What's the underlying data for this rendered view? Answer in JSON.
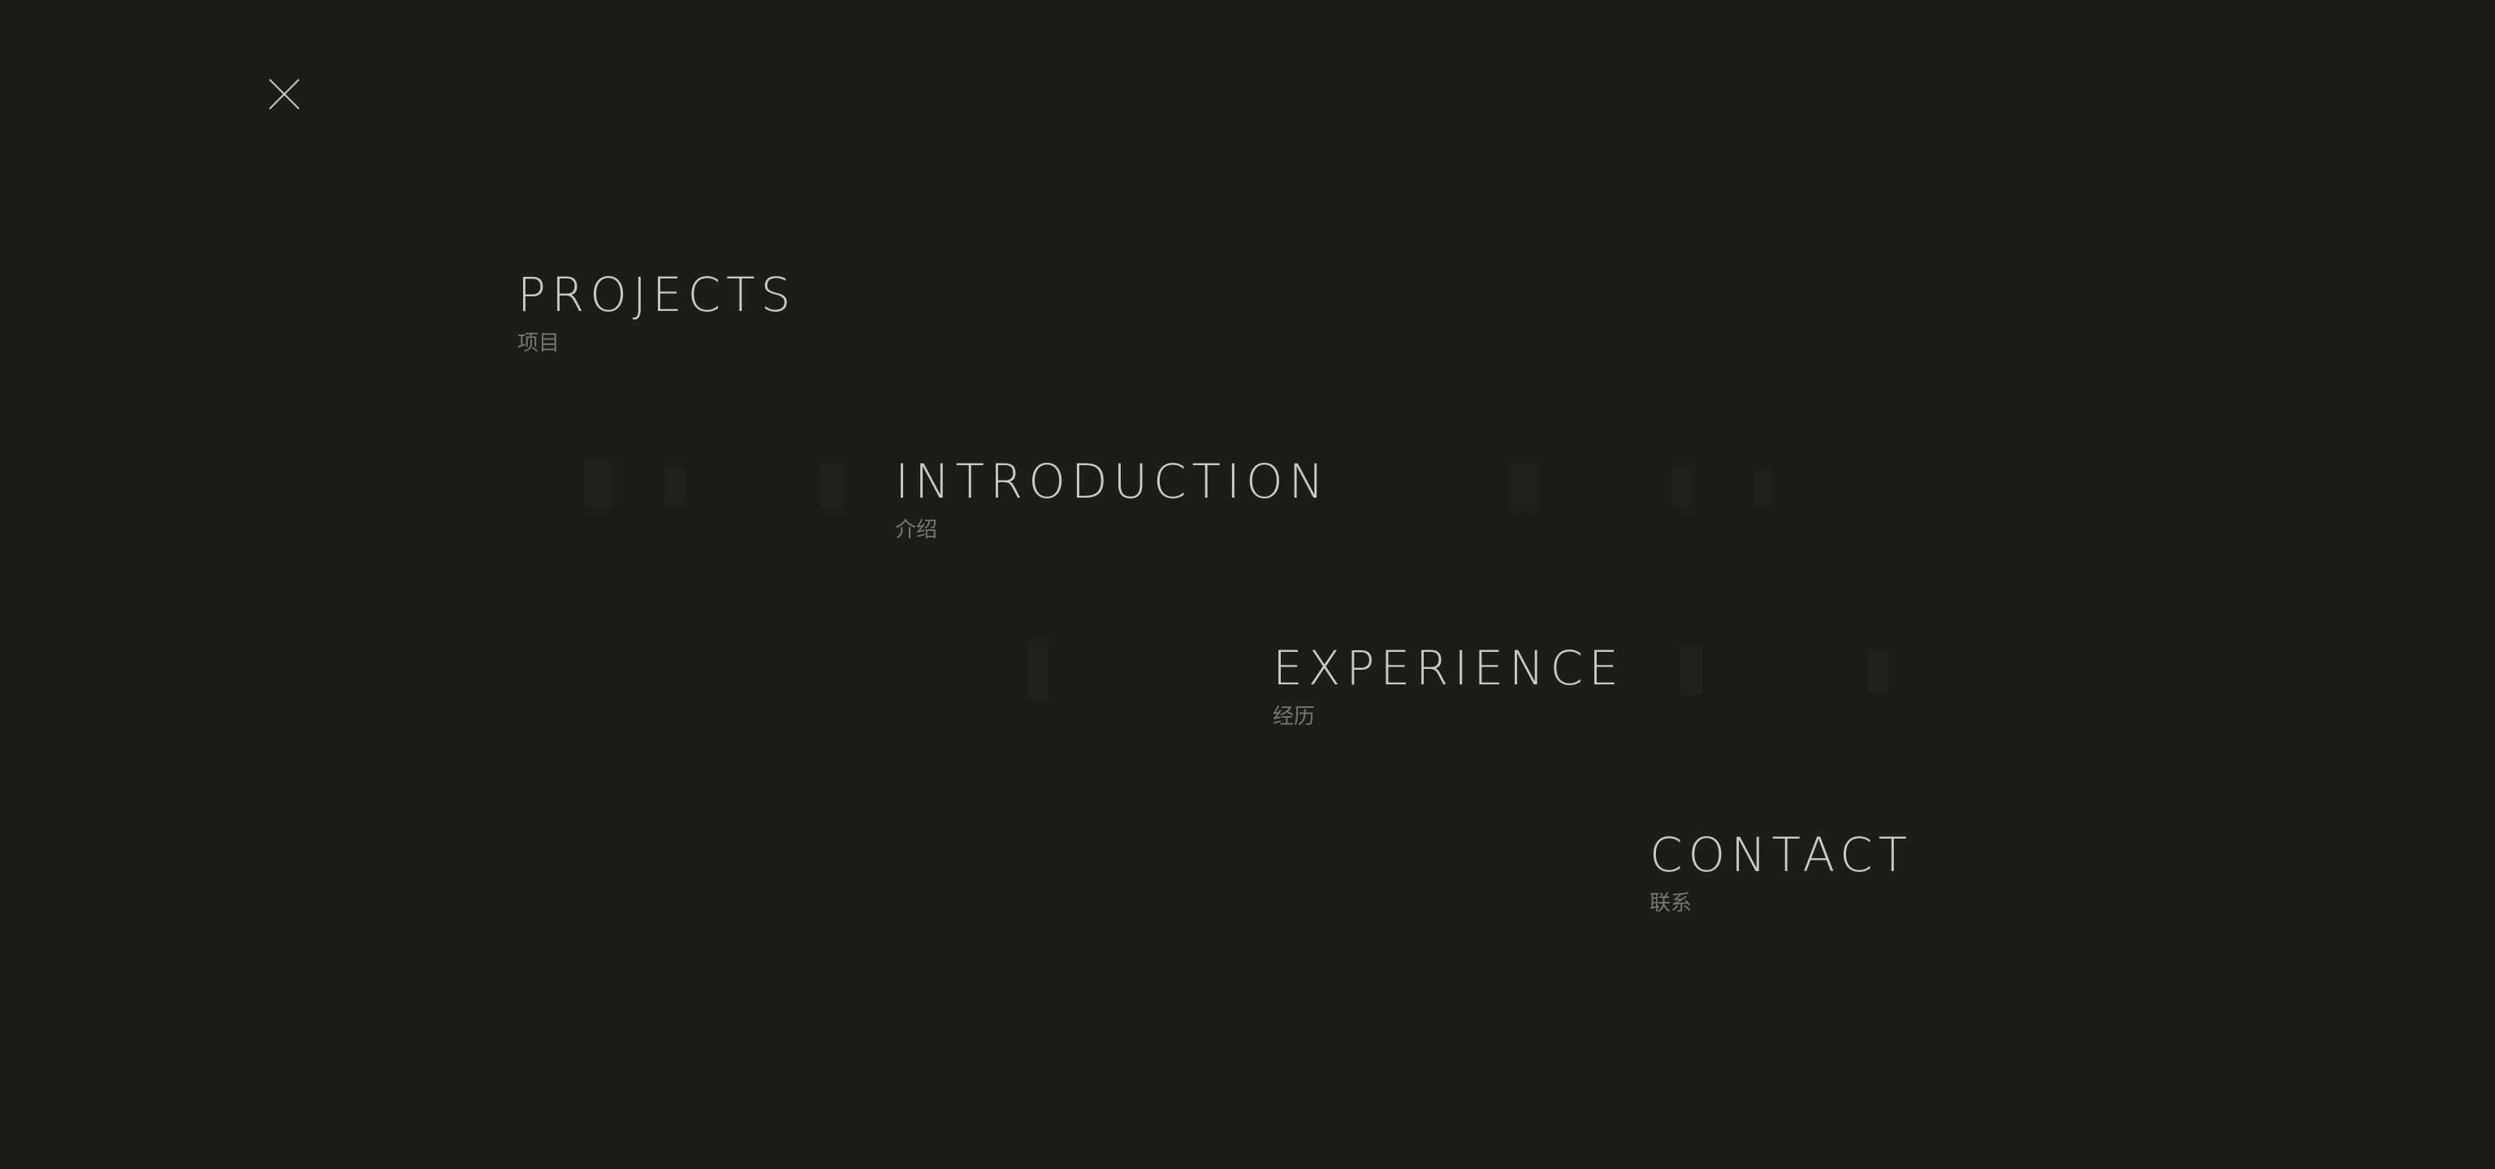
{
  "menu": {
    "close_icon": "close-icon",
    "items": [
      {
        "title": "PROJECTS",
        "subtitle": "项目"
      },
      {
        "title": "INTRODUCTION",
        "subtitle": "介绍"
      },
      {
        "title": "EXPERIENCE",
        "subtitle": "经历"
      },
      {
        "title": "CONTACT",
        "subtitle": "联系"
      }
    ]
  },
  "colors": {
    "background": "#1c1c1a",
    "title": "#c9c9c6",
    "subtitle": "#77776f"
  }
}
